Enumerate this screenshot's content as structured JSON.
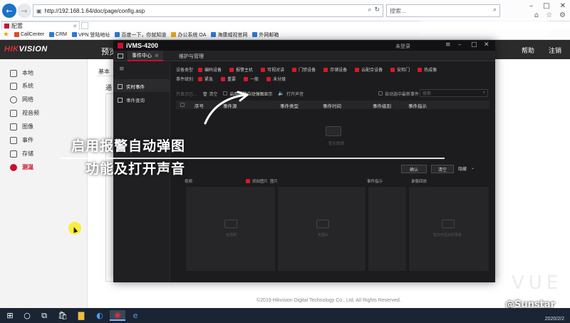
{
  "browser": {
    "url": "http://192.168.1.64/doc/page/config.asp",
    "search_placeholder": "搜索...",
    "tab_title": "配置",
    "favorites": [
      {
        "label": "CallCenter",
        "color": "#e04b2a"
      },
      {
        "label": "CRM",
        "color": "#2a7ad6"
      },
      {
        "label": "VPN 登陆地址",
        "color": "#2a7ad6"
      },
      {
        "label": "百度一下，你就知道",
        "color": "#2a7ad6"
      },
      {
        "label": "办公系统 OA",
        "color": "#e6a817"
      },
      {
        "label": "海康威视官网",
        "color": "#2a7ad6"
      },
      {
        "label": "外网邮箱",
        "color": "#2a7ad6"
      }
    ]
  },
  "webui": {
    "logo_a": "HIK",
    "logo_b": "VISION",
    "nav_preview": "预览",
    "right_help": "帮助",
    "right_logout": "注销",
    "sidebar": [
      {
        "label": "本地",
        "icon": "monitor-icon"
      },
      {
        "label": "系统",
        "icon": "system-icon"
      },
      {
        "label": "网络",
        "icon": "globe-icon"
      },
      {
        "label": "视音频",
        "icon": "video-icon"
      },
      {
        "label": "图像",
        "icon": "image-icon"
      },
      {
        "label": "事件",
        "icon": "event-icon"
      },
      {
        "label": "存储",
        "icon": "storage-icon"
      },
      {
        "label": "测温",
        "icon": "thermometer-icon"
      }
    ],
    "frag_basic": "基本",
    "frag_general": "通",
    "copyright": "©2019 Hikvision Digital Technology Co., Ltd. All Rights Reserved."
  },
  "ivms": {
    "app_name": "iVMS-4200",
    "user": "未登录",
    "tabs": [
      {
        "label": "事件中心",
        "active": true
      },
      {
        "label": "维护与管理",
        "active": false
      }
    ],
    "left_nav": [
      {
        "label": "实时事件",
        "active": true
      },
      {
        "label": "事件查询",
        "active": false
      }
    ],
    "filter_device_label": "设备类型",
    "filter_device": [
      "编码设备",
      "报警主机",
      "可视对讲",
      "门禁设备",
      "存储设备",
      "云配合设备",
      "安检门",
      "热成像"
    ],
    "filter_event_label": "事件级别",
    "filter_event": [
      "紧急",
      "重要",
      "一般",
      "未分级"
    ],
    "toolbar": {
      "dim1": "只显示已...",
      "clear": "清空",
      "popup": "启用报警自动弹图显示",
      "sound": "打开声音",
      "auto_select": "自动选中最新事件",
      "search_placeholder": "搜索"
    },
    "columns": [
      "序号",
      "事件源",
      "事件类型",
      "事件时间",
      "事件级别",
      "事件指示"
    ],
    "empty_text": "暂无数据",
    "buttons": {
      "ack": "确认",
      "clear2": "清空",
      "hide": "隐藏"
    },
    "panel_heads": {
      "video": "视频",
      "photo": "抓拍图片",
      "pic": "图片",
      "detail": "事件指示",
      "record": "录像回放"
    },
    "panel_texts": [
      "无视频",
      "无图片",
      "暂无可显示的录像"
    ]
  },
  "overlay": {
    "caption_1": "启用报警自动弹图",
    "caption_2": "功能及打开声音",
    "watermark_1": "VUE",
    "watermark_2": "@Sunstar"
  },
  "taskbar": {
    "time": "2020/2/2"
  }
}
